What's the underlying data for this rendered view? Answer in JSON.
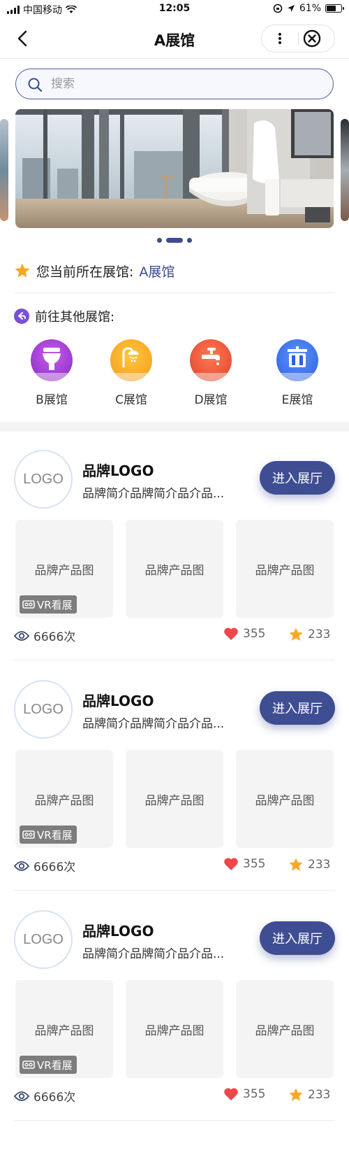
{
  "status_bar": {
    "carrier": "中国移动",
    "time": "12:05",
    "battery": "61%",
    "battery_level": 0.61
  },
  "nav": {
    "title": "A展馆"
  },
  "search": {
    "placeholder": "搜索"
  },
  "banner": {
    "slides": 3,
    "active_index": 1
  },
  "current_hall": {
    "label": "您当前所在展馆:",
    "value": "A展馆"
  },
  "goto": {
    "label": "前往其他展馆:"
  },
  "halls": [
    {
      "name": "B展馆",
      "color": "#a23fd9",
      "icon": "washbasin-icon"
    },
    {
      "name": "C展馆",
      "color": "#f6a623",
      "icon": "shower-icon"
    },
    {
      "name": "D展馆",
      "color": "#f0543a",
      "icon": "faucet-icon"
    },
    {
      "name": "E展馆",
      "color": "#3f74ee",
      "icon": "cabinet-icon"
    }
  ],
  "brands": [
    {
      "logo": "LOGO",
      "name": "品牌LOGO",
      "desc": "品牌简介品牌简介品介品...",
      "enter": "进入展厅",
      "products": [
        "品牌产品图",
        "品牌产品图",
        "品牌产品图"
      ],
      "vr_label": "VR看展",
      "views": "6666次",
      "likes": "355",
      "favorites": "233"
    },
    {
      "logo": "LOGO",
      "name": "品牌LOGO",
      "desc": "品牌简介品牌简介品介品...",
      "enter": "进入展厅",
      "products": [
        "品牌产品图",
        "品牌产品图",
        "品牌产品图"
      ],
      "vr_label": "VR看展",
      "views": "6666次",
      "likes": "355",
      "favorites": "233"
    },
    {
      "logo": "LOGO",
      "name": "品牌LOGO",
      "desc": "品牌简介品牌简介品介品...",
      "enter": "进入展厅",
      "products": [
        "品牌产品图",
        "品牌产品图",
        "品牌产品图"
      ],
      "vr_label": "VR看展",
      "views": "6666次",
      "likes": "355",
      "favorites": "233"
    }
  ]
}
